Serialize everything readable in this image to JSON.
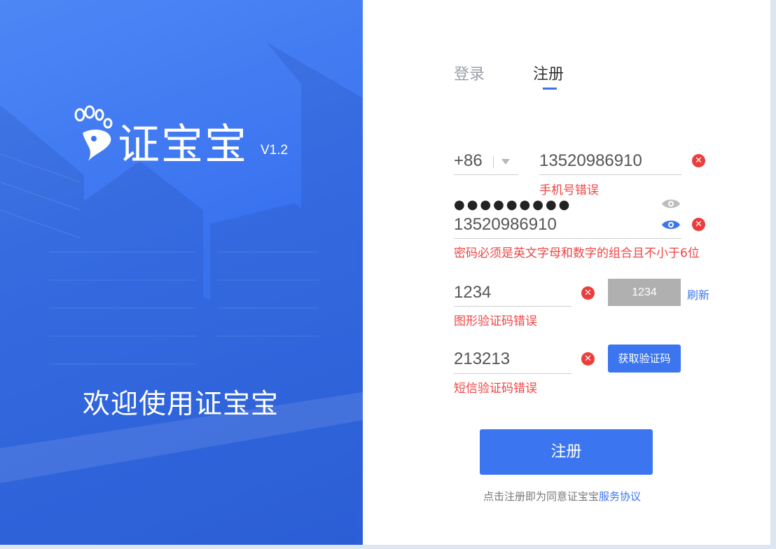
{
  "brand": {
    "name": "证宝宝",
    "version": "V1.2",
    "welcome": "欢迎使用证宝宝"
  },
  "tabs": {
    "login": "登录",
    "register": "注册",
    "active": "register"
  },
  "form": {
    "country_code": "+86",
    "phone_value": "13520986910",
    "phone_error": "手机号错误",
    "password_masked": "●●●●●●●●●",
    "password_visible": "13520986910",
    "password_error": "密码必须是英文字母和数字的组合且不小于6位",
    "captcha_value": "1234",
    "captcha_image_text": "1234",
    "captcha_refresh": "刷新",
    "captcha_error": "图形验证码错误",
    "sms_value": "213213",
    "sms_button": "获取验证码",
    "sms_error": "短信验证码错误",
    "submit_label": "注册",
    "agreement_prefix": "点击注册即为同意证宝宝",
    "agreement_link": "服务协议",
    "clear_glyph": "✕"
  },
  "colors": {
    "brand_blue": "#3b76f0",
    "error_red": "#f04444",
    "captcha_gray": "#b0b0b0",
    "eye_inactive": "#bdbdbd",
    "eye_active": "#3b76f0"
  }
}
